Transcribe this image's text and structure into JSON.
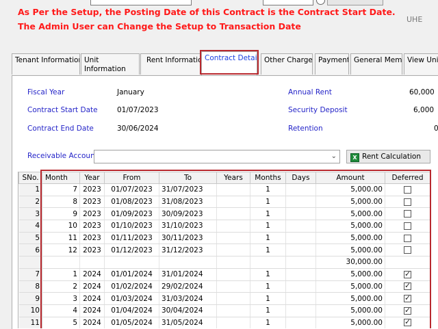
{
  "warnings": {
    "line1": "As Per the Setup, the Posting Date of this Contract is the Contract Start Date.",
    "line2": "The Admin User can Change the Setup to Transaction Date",
    "corner": "UHE"
  },
  "tabs": [
    {
      "label": "Tenant Information",
      "active": false
    },
    {
      "label": "Unit Information",
      "active": false
    },
    {
      "label": "Rent Information",
      "active": false
    },
    {
      "label": "Contract Details",
      "active": true
    },
    {
      "label": "Other Charges",
      "active": false
    },
    {
      "label": "Payment",
      "active": false
    },
    {
      "label": "General Memo",
      "active": false
    },
    {
      "label": "View Uni",
      "active": false
    }
  ],
  "details": {
    "fiscal_year_label": "Fiscal Year",
    "fiscal_year_value": "January",
    "start_label": "Contract Start Date",
    "start_value": "01/07/2023",
    "end_label": "Contract End Date",
    "end_value": "30/06/2024",
    "annual_rent_label": "Annual Rent",
    "annual_rent_value": "60,000",
    "security_label": "Security Deposit",
    "security_value": "6,000",
    "retention_label": "Retention",
    "retention_value": "0",
    "receivable_label": "Receivable Account",
    "receivable_value": "",
    "rent_calc_label": "Rent Calculation"
  },
  "grid": {
    "columns": [
      "SNo.",
      "Month",
      "Year",
      "From",
      "To",
      "Years",
      "Months",
      "Days",
      "Amount",
      "Deferred"
    ],
    "rows": [
      {
        "sno": "1",
        "month": "7",
        "year": "2023",
        "from": "01/07/2023",
        "to": "31/07/2023",
        "years": "",
        "months": "1",
        "days": "",
        "amount": "5,000.00",
        "deferred": false,
        "subtotal": false
      },
      {
        "sno": "2",
        "month": "8",
        "year": "2023",
        "from": "01/08/2023",
        "to": "31/08/2023",
        "years": "",
        "months": "1",
        "days": "",
        "amount": "5,000.00",
        "deferred": false,
        "subtotal": false
      },
      {
        "sno": "3",
        "month": "9",
        "year": "2023",
        "from": "01/09/2023",
        "to": "30/09/2023",
        "years": "",
        "months": "1",
        "days": "",
        "amount": "5,000.00",
        "deferred": false,
        "subtotal": false
      },
      {
        "sno": "4",
        "month": "10",
        "year": "2023",
        "from": "01/10/2023",
        "to": "31/10/2023",
        "years": "",
        "months": "1",
        "days": "",
        "amount": "5,000.00",
        "deferred": false,
        "subtotal": false
      },
      {
        "sno": "5",
        "month": "11",
        "year": "2023",
        "from": "01/11/2023",
        "to": "30/11/2023",
        "years": "",
        "months": "1",
        "days": "",
        "amount": "5,000.00",
        "deferred": false,
        "subtotal": false
      },
      {
        "sno": "6",
        "month": "12",
        "year": "2023",
        "from": "01/12/2023",
        "to": "31/12/2023",
        "years": "",
        "months": "1",
        "days": "",
        "amount": "5,000.00",
        "deferred": false,
        "subtotal": false
      },
      {
        "sno": "",
        "month": "",
        "year": "",
        "from": "",
        "to": "",
        "years": "",
        "months": "",
        "days": "",
        "amount": "30,000.00",
        "deferred": null,
        "subtotal": true
      },
      {
        "sno": "7",
        "month": "1",
        "year": "2024",
        "from": "01/01/2024",
        "to": "31/01/2024",
        "years": "",
        "months": "1",
        "days": "",
        "amount": "5,000.00",
        "deferred": true,
        "subtotal": false
      },
      {
        "sno": "8",
        "month": "2",
        "year": "2024",
        "from": "01/02/2024",
        "to": "29/02/2024",
        "years": "",
        "months": "1",
        "days": "",
        "amount": "5,000.00",
        "deferred": true,
        "subtotal": false
      },
      {
        "sno": "9",
        "month": "3",
        "year": "2024",
        "from": "01/03/2024",
        "to": "31/03/2024",
        "years": "",
        "months": "1",
        "days": "",
        "amount": "5,000.00",
        "deferred": true,
        "subtotal": false
      },
      {
        "sno": "10",
        "month": "4",
        "year": "2024",
        "from": "01/04/2024",
        "to": "30/04/2024",
        "years": "",
        "months": "1",
        "days": "",
        "amount": "5,000.00",
        "deferred": true,
        "subtotal": false
      },
      {
        "sno": "11",
        "month": "5",
        "year": "2024",
        "from": "01/05/2024",
        "to": "31/05/2024",
        "years": "",
        "months": "1",
        "days": "",
        "amount": "5,000.00",
        "deferred": true,
        "subtotal": false
      }
    ]
  },
  "colors": {
    "warning": "#ff1a1a",
    "label_blue": "#2424c8",
    "highlight": "#b8282e"
  }
}
